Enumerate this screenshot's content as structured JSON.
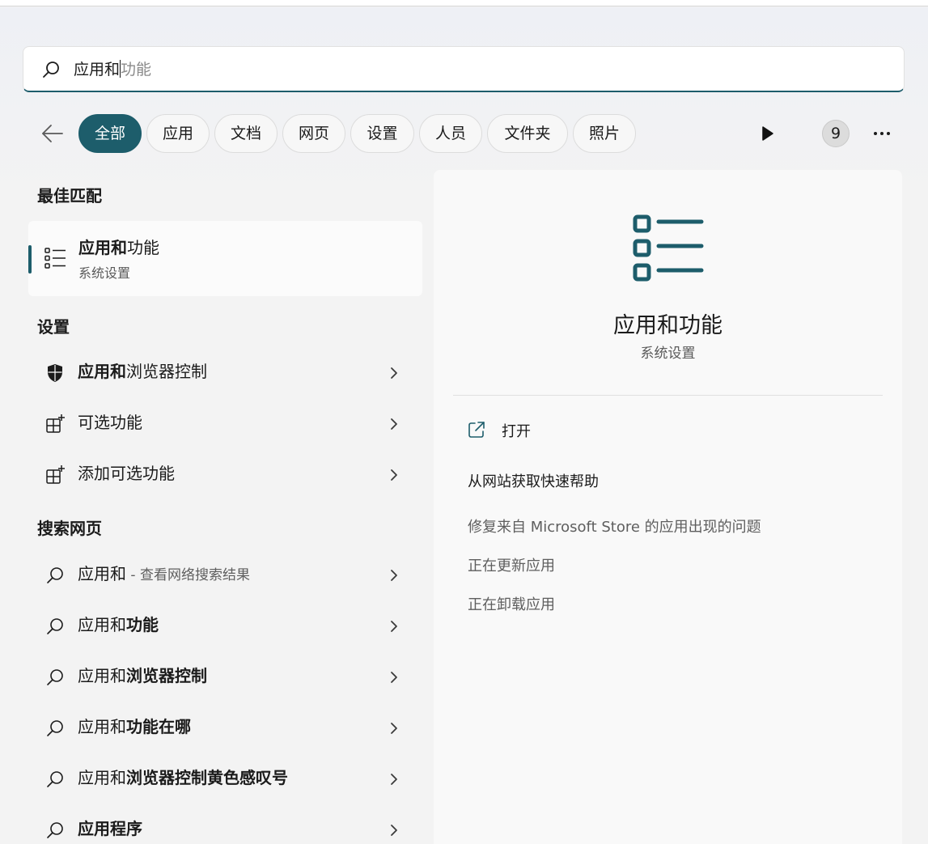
{
  "search": {
    "typed": "应用和",
    "suggestion": "功能"
  },
  "filters": {
    "back_icon": "back-arrow-icon",
    "tabs": [
      {
        "label": "全部",
        "active": true
      },
      {
        "label": "应用"
      },
      {
        "label": "文档"
      },
      {
        "label": "网页"
      },
      {
        "label": "设置"
      },
      {
        "label": "人员"
      },
      {
        "label": "文件夹"
      },
      {
        "label": "照片"
      }
    ],
    "play_icon": "play-icon",
    "badge": "9",
    "more_icon": "more-icon"
  },
  "best_match": {
    "heading": "最佳匹配",
    "title_bold": "应用和",
    "title_rest": "功能",
    "subtitle": "系统设置",
    "icon": "list-settings-icon"
  },
  "settings": {
    "heading": "设置",
    "items": [
      {
        "bold": "应用和",
        "rest": "浏览器控制",
        "icon": "shield-icon"
      },
      {
        "bold": "",
        "rest": "可选功能",
        "icon": "add-apps-icon"
      },
      {
        "bold": "",
        "rest": "添加可选功能",
        "icon": "add-apps-icon"
      }
    ]
  },
  "web": {
    "heading": "搜索网页",
    "items": [
      {
        "normal": "应用和",
        "muted": " - 查看网络搜索结果",
        "bold": ""
      },
      {
        "normal": "应用和",
        "bold": "功能"
      },
      {
        "normal": "应用和",
        "bold": "浏览器控制"
      },
      {
        "normal": "应用和",
        "bold": "功能在哪"
      },
      {
        "normal": "应用和",
        "bold": "浏览器控制黄色感叹号"
      },
      {
        "normal": "",
        "bold": "应用程序"
      }
    ]
  },
  "detail": {
    "title": "应用和功能",
    "subtitle": "系统设置",
    "open_label": "打开",
    "help_title": "从网站获取快速帮助",
    "links": [
      "修复来自 Microsoft Store 的应用出现的问题",
      "正在更新应用",
      "正在卸载应用"
    ]
  },
  "colors": {
    "accent": "#1d5d6b"
  }
}
